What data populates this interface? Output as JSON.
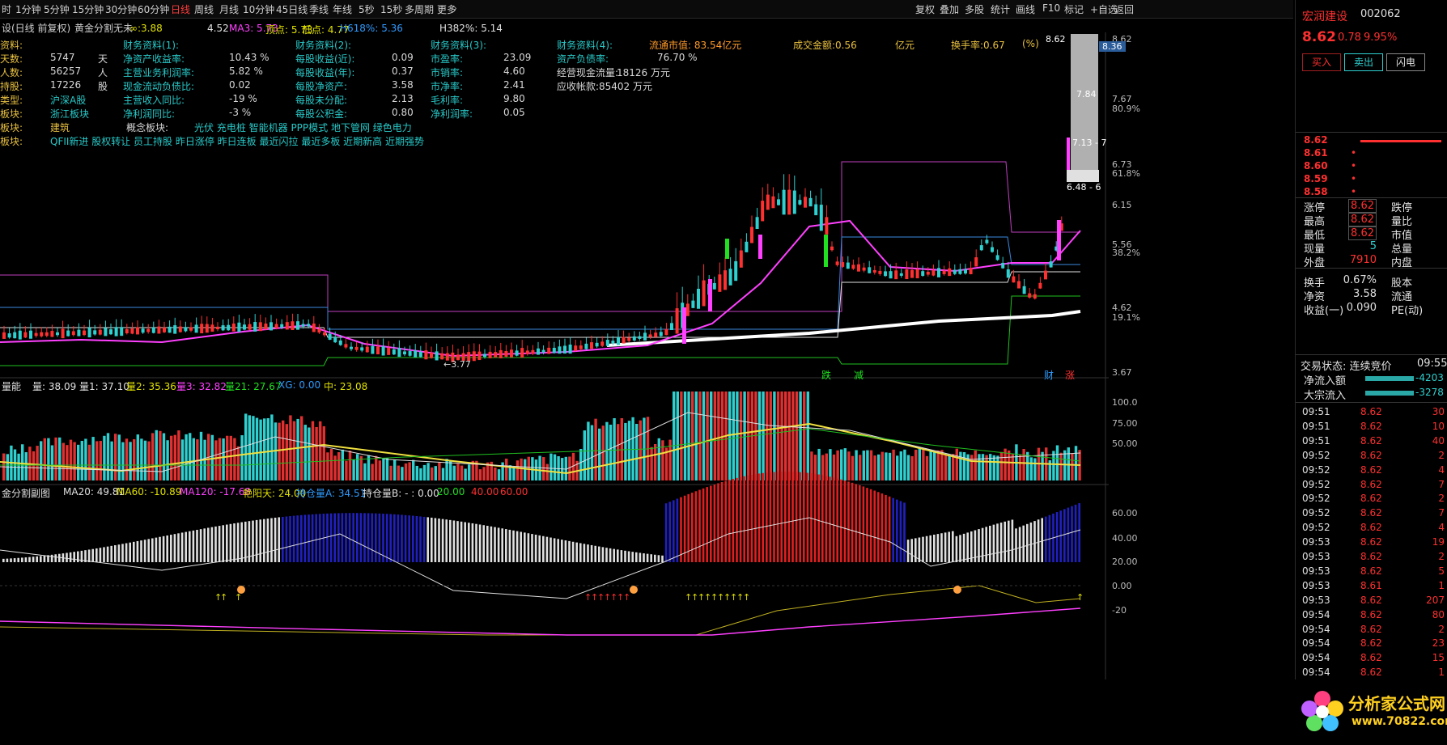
{
  "menu": {
    "tabs": [
      "时",
      "1分钟",
      "5分钟",
      "15分钟",
      "30分钟",
      "60分钟",
      "日线",
      "周线",
      "月线",
      "10分钟",
      "45日线",
      "季线",
      "年线",
      "5秒",
      "15秒",
      "多周期",
      "更多"
    ],
    "active_index": 6,
    "right": [
      "复权",
      "叠加",
      "多股",
      "统计",
      "画线",
      "F10",
      "标记",
      "+自选",
      "返回"
    ]
  },
  "indicator_header": {
    "title": "设(日线 前复权)",
    "name": "黄金分割无未",
    "items": [
      {
        "text": "3.88",
        "color": "#e0e000"
      },
      {
        "text": "4.52",
        "color": "#e0e0e0"
      },
      {
        "text": "MA3: 5.73",
        "color": "#ff40ff"
      },
      {
        "text": "顶点: 5.73",
        "color": "#e0e000"
      },
      {
        "text": "低点: 4.77",
        "color": "#e0e000"
      },
      {
        "text": "H618%: 5.36",
        "color": "#2e9bff"
      },
      {
        "text": "H382%: 5.14",
        "color": "#e0e0e0"
      }
    ]
  },
  "fundamentals": {
    "col0": [
      {
        "label": "资料:",
        "value": "",
        "unit": ""
      },
      {
        "label": "天数:",
        "value": "5747",
        "unit": "天"
      },
      {
        "label": "人数:",
        "value": "56257",
        "unit": "人"
      },
      {
        "label": "持股:",
        "value": "17226",
        "unit": "股"
      },
      {
        "label": "类型:",
        "value": "沪深A股",
        "unit": ""
      },
      {
        "label": "板块:",
        "value": "浙江板块",
        "unit": ""
      },
      {
        "label": "板块:",
        "value": "建筑",
        "unit": ""
      },
      {
        "label": "板块:",
        "value": "QFII新进 股权转让 员工持股 昨日涨停 昨日连板 最近闪拉 最近多板 近期新高 近期强势",
        "unit": ""
      }
    ],
    "col1_title": "财务资料(1):",
    "col1": [
      {
        "label": "净资产收益率:",
        "value": "10.43 %"
      },
      {
        "label": "主营业务利润率:",
        "value": "5.82 %"
      },
      {
        "label": "现金流动负债比:",
        "value": "0.02"
      },
      {
        "label": "主营收入同比:",
        "value": "-19 %"
      },
      {
        "label": "净利润同比:",
        "value": "-3 %"
      }
    ],
    "col2_title": "财务资料(2):",
    "col2": [
      {
        "label": "每股收益(近):",
        "value": "0.09"
      },
      {
        "label": "每股收益(年):",
        "value": "0.37"
      },
      {
        "label": "每股净资产:",
        "value": "3.58"
      },
      {
        "label": "每股未分配:",
        "value": "2.13"
      },
      {
        "label": "每股公积金:",
        "value": "0.80"
      }
    ],
    "col3_title": "财务资料(3):",
    "col3": [
      {
        "label": "市盈率:",
        "value": "23.09"
      },
      {
        "label": "市销率:",
        "value": "4.60"
      },
      {
        "label": "市净率:",
        "value": "2.41"
      },
      {
        "label": "毛利率:",
        "value": "9.80"
      },
      {
        "label": "净利润率:",
        "value": "0.05"
      }
    ],
    "col4_title": "财务资料(4):",
    "col4": [
      {
        "label": "资产负债率:",
        "value": "76.70 %"
      },
      {
        "label": "经营现金流量:",
        "value": "18126 万元"
      },
      {
        "label": "应收帐款:",
        "value": "85402 万元"
      }
    ],
    "concept_label": "概念板块:",
    "concept_value": "光伏 充电桩 智能机器 PPP模式 地下管网 绿色电力",
    "float_cap": "流通市值: 83.54亿元",
    "turnover_amt": "成交金额:0.56",
    "yi": "亿元",
    "turnover_rate": "换手率:0.67",
    "pct": "(%)"
  },
  "price_axis": [
    "8.62",
    "7.67",
    "80.9%",
    "6.73",
    "61.8%",
    "6.15",
    "5.56",
    "38.2%",
    "4.62",
    "19.1%",
    "3.67"
  ],
  "price_tags": [
    "8.36",
    "7.84",
    "7.13 - 7",
    "6.48 - 6"
  ],
  "low_marker": "←3.77",
  "event_marks": [
    "跌",
    "减",
    "财",
    "涨"
  ],
  "volume_header": [
    {
      "text": "量能",
      "color": "#e0e0e0"
    },
    {
      "text": "量: 38.09",
      "color": "#e0e0e0"
    },
    {
      "text": "量1: 37.10",
      "color": "#e0e0e0"
    },
    {
      "text": "量2: 35.36",
      "color": "#e0e000"
    },
    {
      "text": "量3: 32.82",
      "color": "#ff40ff"
    },
    {
      "text": "量21: 27.67",
      "color": "#20e020"
    },
    {
      "text": "XG: 0.00",
      "color": "#2e9bff"
    },
    {
      "text": "中: 23.08",
      "color": "#e0e000"
    }
  ],
  "volume_axis": [
    "100.0",
    "75.00",
    "50.00"
  ],
  "sub_header": [
    {
      "text": "金分割副图",
      "color": "#e0e0e0"
    },
    {
      "text": "MA20: 49.81",
      "color": "#e0e0e0"
    },
    {
      "text": "MA60: -10.89",
      "color": "#e0e000"
    },
    {
      "text": "MA120: -17.68",
      "color": "#ff40ff"
    },
    {
      "text": "艳阳天: 24.00",
      "color": "#e0e000"
    },
    {
      "text": "持仓量A: 34.51",
      "color": "#2e9bff"
    },
    {
      "text": "持仓量B: - : 0.00",
      "color": "#e0e0e0"
    },
    {
      "text": "20.00",
      "color": "#20e020"
    },
    {
      "text": "40.00",
      "color": "#ff3030"
    },
    {
      "text": "60.00",
      "color": "#ff3030"
    }
  ],
  "sub_axis": [
    "60.00",
    "40.00",
    "20.00",
    "0.00",
    "-20"
  ],
  "stock": {
    "name": "宏润建设",
    "code": "002062",
    "price": "8.62",
    "change": "0.78",
    "pct": "9.95%",
    "buttons": [
      "买入",
      "卖出",
      "闪电"
    ]
  },
  "order_book": [
    {
      "label": "8.62",
      "vol": "",
      "bar": true
    },
    {
      "label": "8.61",
      "vol": "•"
    },
    {
      "label": "8.60",
      "vol": "•"
    },
    {
      "label": "8.59",
      "vol": "•"
    },
    {
      "label": "8.58",
      "vol": "•"
    }
  ],
  "quote": [
    {
      "l": "涨停",
      "v": "8.62",
      "r": "跌停",
      "vc": "#ff3030"
    },
    {
      "l": "最高",
      "v": "8.62",
      "r": "量比",
      "vc": "#ff3030"
    },
    {
      "l": "最低",
      "v": "8.62",
      "r": "市值",
      "vc": "#ff3030"
    },
    {
      "l": "现量",
      "v": "5",
      "r": "总量",
      "vc": "#2ed0d0"
    },
    {
      "l": "外盘",
      "v": "7910",
      "r": "内盘",
      "vc": "#ff3030"
    },
    {
      "l": "换手",
      "v": "0.67%",
      "r": "股本",
      "vc": "#e0e0e0"
    },
    {
      "l": "净资",
      "v": "3.58",
      "r": "流通",
      "vc": "#e0e0e0"
    },
    {
      "l": "收益(一)",
      "v": "0.090",
      "r": "PE(动)",
      "vc": "#e0e0e0"
    }
  ],
  "trade_state": "交易状态: 连续竞价",
  "trade_time": "09:55",
  "flows": [
    {
      "label": "净流入额",
      "value": "-4203"
    },
    {
      "label": "大宗流入",
      "value": "-3278"
    }
  ],
  "ticks": [
    {
      "t": "09:51",
      "p": "8.62",
      "v": "30"
    },
    {
      "t": "09:51",
      "p": "8.62",
      "v": "10"
    },
    {
      "t": "09:51",
      "p": "8.62",
      "v": "40"
    },
    {
      "t": "09:52",
      "p": "8.62",
      "v": "2"
    },
    {
      "t": "09:52",
      "p": "8.62",
      "v": "4"
    },
    {
      "t": "09:52",
      "p": "8.62",
      "v": "7"
    },
    {
      "t": "09:52",
      "p": "8.62",
      "v": "2"
    },
    {
      "t": "09:52",
      "p": "8.62",
      "v": "7"
    },
    {
      "t": "09:52",
      "p": "8.62",
      "v": "4"
    },
    {
      "t": "09:53",
      "p": "8.62",
      "v": "19"
    },
    {
      "t": "09:53",
      "p": "8.62",
      "v": "2"
    },
    {
      "t": "09:53",
      "p": "8.62",
      "v": "5"
    },
    {
      "t": "09:53",
      "p": "8.61",
      "v": "1"
    },
    {
      "t": "09:53",
      "p": "8.62",
      "v": "207"
    },
    {
      "t": "09:54",
      "p": "8.62",
      "v": "80"
    },
    {
      "t": "09:54",
      "p": "8.62",
      "v": "2"
    },
    {
      "t": "09:54",
      "p": "8.62",
      "v": "23"
    },
    {
      "t": "09:54",
      "p": "8.62",
      "v": "15"
    },
    {
      "t": "09:54",
      "p": "8.62",
      "v": "1"
    },
    {
      "t": "09:54",
      "p": "8.62",
      "v": "1"
    }
  ],
  "logo": {
    "cn": "分析家公式网",
    "url": "www.70822.com"
  },
  "watermark": "分析家公式网www.70822.Com",
  "colors": {
    "up": "#ff3030",
    "down": "#2ed0d0",
    "ma": "#ff40ff",
    "grid": "#2a2a2a"
  }
}
